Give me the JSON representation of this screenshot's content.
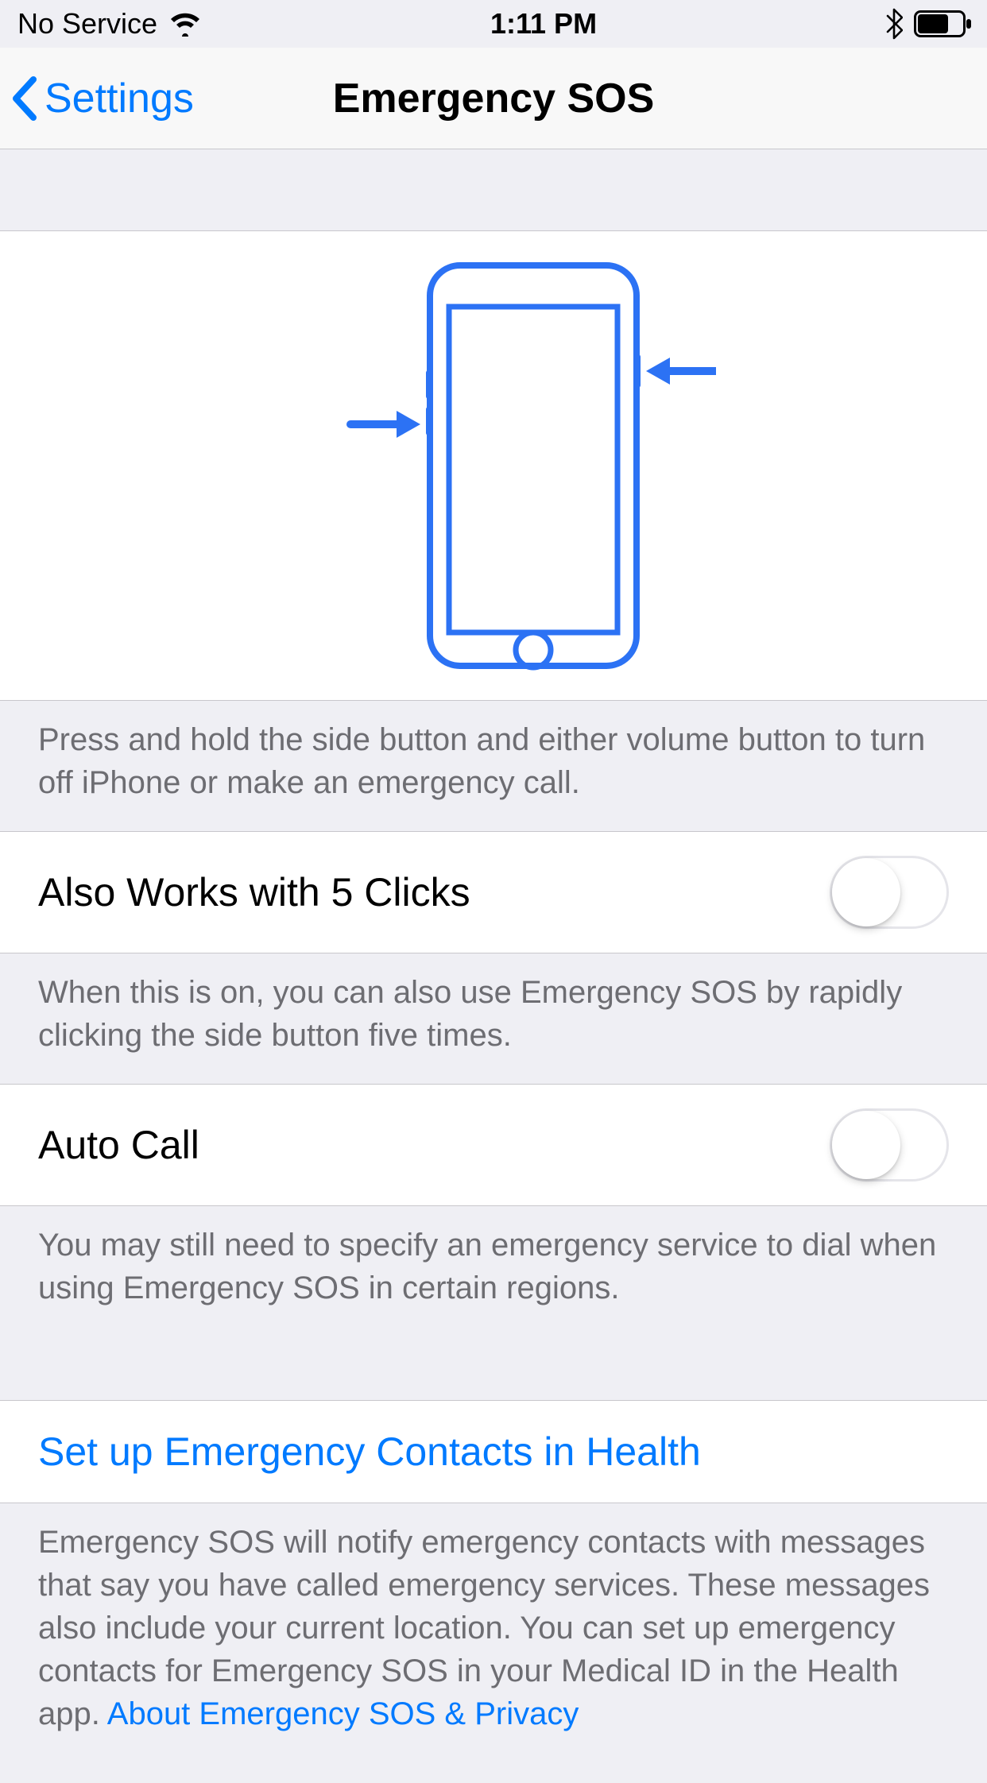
{
  "status": {
    "carrier": "No Service",
    "time": "1:11 PM"
  },
  "nav": {
    "back_label": "Settings",
    "title": "Emergency SOS"
  },
  "illustration_footer": "Press and hold the side button and either volume button to turn off iPhone or make an emergency call.",
  "five_clicks": {
    "label": "Also Works with 5 Clicks",
    "footer": "When this is on, you can also use Emergency SOS by rapidly clicking the side button five times."
  },
  "auto_call": {
    "label": "Auto Call",
    "footer": "You may still need to specify an emergency service to dial when using Emergency SOS in certain regions."
  },
  "health": {
    "link_label": "Set up Emergency Contacts in Health",
    "footer_text": "Emergency SOS will notify emergency contacts with messages that say you have called emergency services. These messages also include your current location. You can set up emergency contacts for Emergency SOS in your Medical ID in the Health app. ",
    "footer_link": "About Emergency SOS & Privacy"
  },
  "colors": {
    "accent": "#007AFF",
    "bg": "#EFEFF4",
    "secondary_text": "#6D6D72",
    "hairline": "#C8C7CC"
  }
}
